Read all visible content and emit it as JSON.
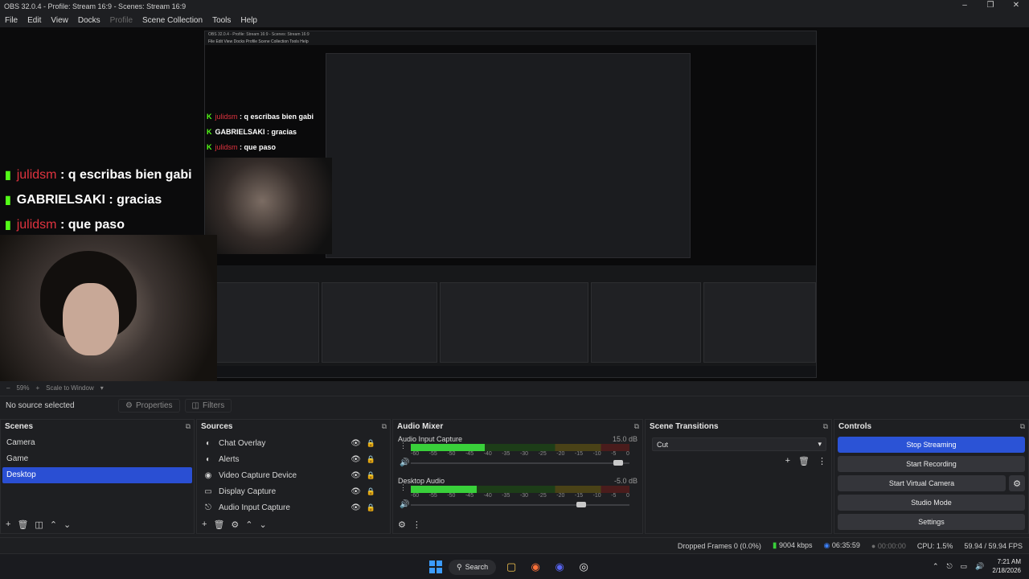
{
  "window": {
    "title": "OBS 32.0.4 - Profile: Stream 16:9 - Scenes: Stream 16:9"
  },
  "menu": [
    "File",
    "Edit",
    "View",
    "Docks",
    "Profile",
    "Scene Collection",
    "Tools",
    "Help"
  ],
  "preview": {
    "chat": [
      {
        "user": "julidsm",
        "message": ": q escribas bien gabi"
      },
      {
        "user": "GABRIELSAKI",
        "message": ": gracias"
      },
      {
        "user": "julidsm",
        "message": ": que paso"
      }
    ],
    "zoom": "59%",
    "scale_mode": "Scale to Window",
    "nested_title": "OBS 32.0.4 - Profile: Stream 16:9 - Scenes: Stream 16:9",
    "nested_menu": "File  Edit  View  Docks  Profile  Scene Collection  Tools  Help"
  },
  "toolbar": {
    "no_source": "No source selected",
    "properties": "Properties",
    "filters": "Filters"
  },
  "scenes": {
    "title": "Scenes",
    "items": [
      "Camera",
      "Game",
      "Desktop"
    ],
    "selected": "Desktop"
  },
  "sources": {
    "title": "Sources",
    "items": [
      {
        "label": "Chat Overlay",
        "icon": "globe-icon"
      },
      {
        "label": "Alerts",
        "icon": "globe-icon"
      },
      {
        "label": "Video Capture Device",
        "icon": "camera-icon"
      },
      {
        "label": "Display Capture",
        "icon": "monitor-icon"
      },
      {
        "label": "Audio Input Capture",
        "icon": "microphone-icon"
      }
    ]
  },
  "mixer": {
    "title": "Audio Mixer",
    "channels": [
      {
        "name": "Audio Input Capture",
        "db": "15.0 dB",
        "level": 0.34,
        "volume": 0.97
      },
      {
        "name": "Desktop Audio",
        "db": "-5.0 dB",
        "level": 0.3,
        "volume": 0.8
      }
    ],
    "ticks": [
      "-60",
      "-55",
      "-50",
      "-45",
      "-40",
      "-35",
      "-30",
      "-25",
      "-20",
      "-15",
      "-10",
      "-5",
      "0"
    ]
  },
  "transitions": {
    "title": "Scene Transitions",
    "selected": "Cut"
  },
  "controls": {
    "title": "Controls",
    "stop_streaming": "Stop Streaming",
    "start_recording": "Start Recording",
    "start_virtual_camera": "Start Virtual Camera",
    "studio_mode": "Studio Mode",
    "settings": "Settings"
  },
  "status": {
    "dropped_frames": "Dropped Frames 0 (0.0%)",
    "bitrate": "9004 kbps",
    "stream_time": "06:35:59",
    "record_time": "00:00:00",
    "cpu": "CPU: 1.5%",
    "fps": "59.94 / 59.94 FPS"
  },
  "taskbar": {
    "search": "Search",
    "time": "7:21 AM",
    "date": "2/18/2026"
  },
  "colors": {
    "accent": "#2b53d6",
    "kick_green": "#53fc18",
    "chat_user_red": "#e0333f",
    "meter_green": "#39d03a"
  }
}
